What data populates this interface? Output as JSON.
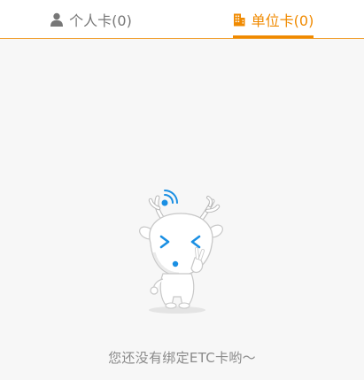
{
  "tabs": {
    "personal": {
      "label": "个人卡(0)",
      "icon": "person-icon",
      "active": false
    },
    "company": {
      "label": "单位卡(0)",
      "icon": "building-icon",
      "active": true
    }
  },
  "colors": {
    "accent": "#f08a00",
    "inactive_text": "#777777",
    "empty_text": "#8a8a8a",
    "background": "#f7f7f7"
  },
  "empty_state": {
    "illustration": "deer-mascot-illustration",
    "message": "您还没有绑定ETC卡哟～"
  }
}
